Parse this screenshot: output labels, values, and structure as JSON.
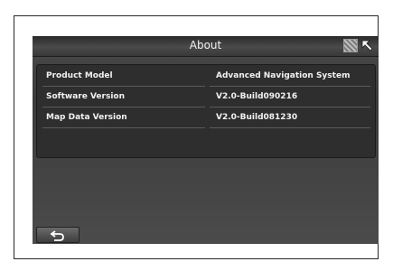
{
  "header": {
    "title": "About",
    "map_icon": "map-grid-icon",
    "cursor_icon": "arrow-cursor-icon"
  },
  "info": {
    "rows": [
      {
        "label": "Product Model",
        "value": "Advanced Navigation System"
      },
      {
        "label": "Software Version",
        "value": "V2.0-Build090216"
      },
      {
        "label": "Map Data Version",
        "value": "V2.0-Build081230"
      }
    ]
  },
  "footer": {
    "back_icon": "back-arrow-icon"
  },
  "colors": {
    "background": "#ffffff",
    "screen": "#444444",
    "panel": "#2e2e2e",
    "text": "#f2f2f2"
  }
}
